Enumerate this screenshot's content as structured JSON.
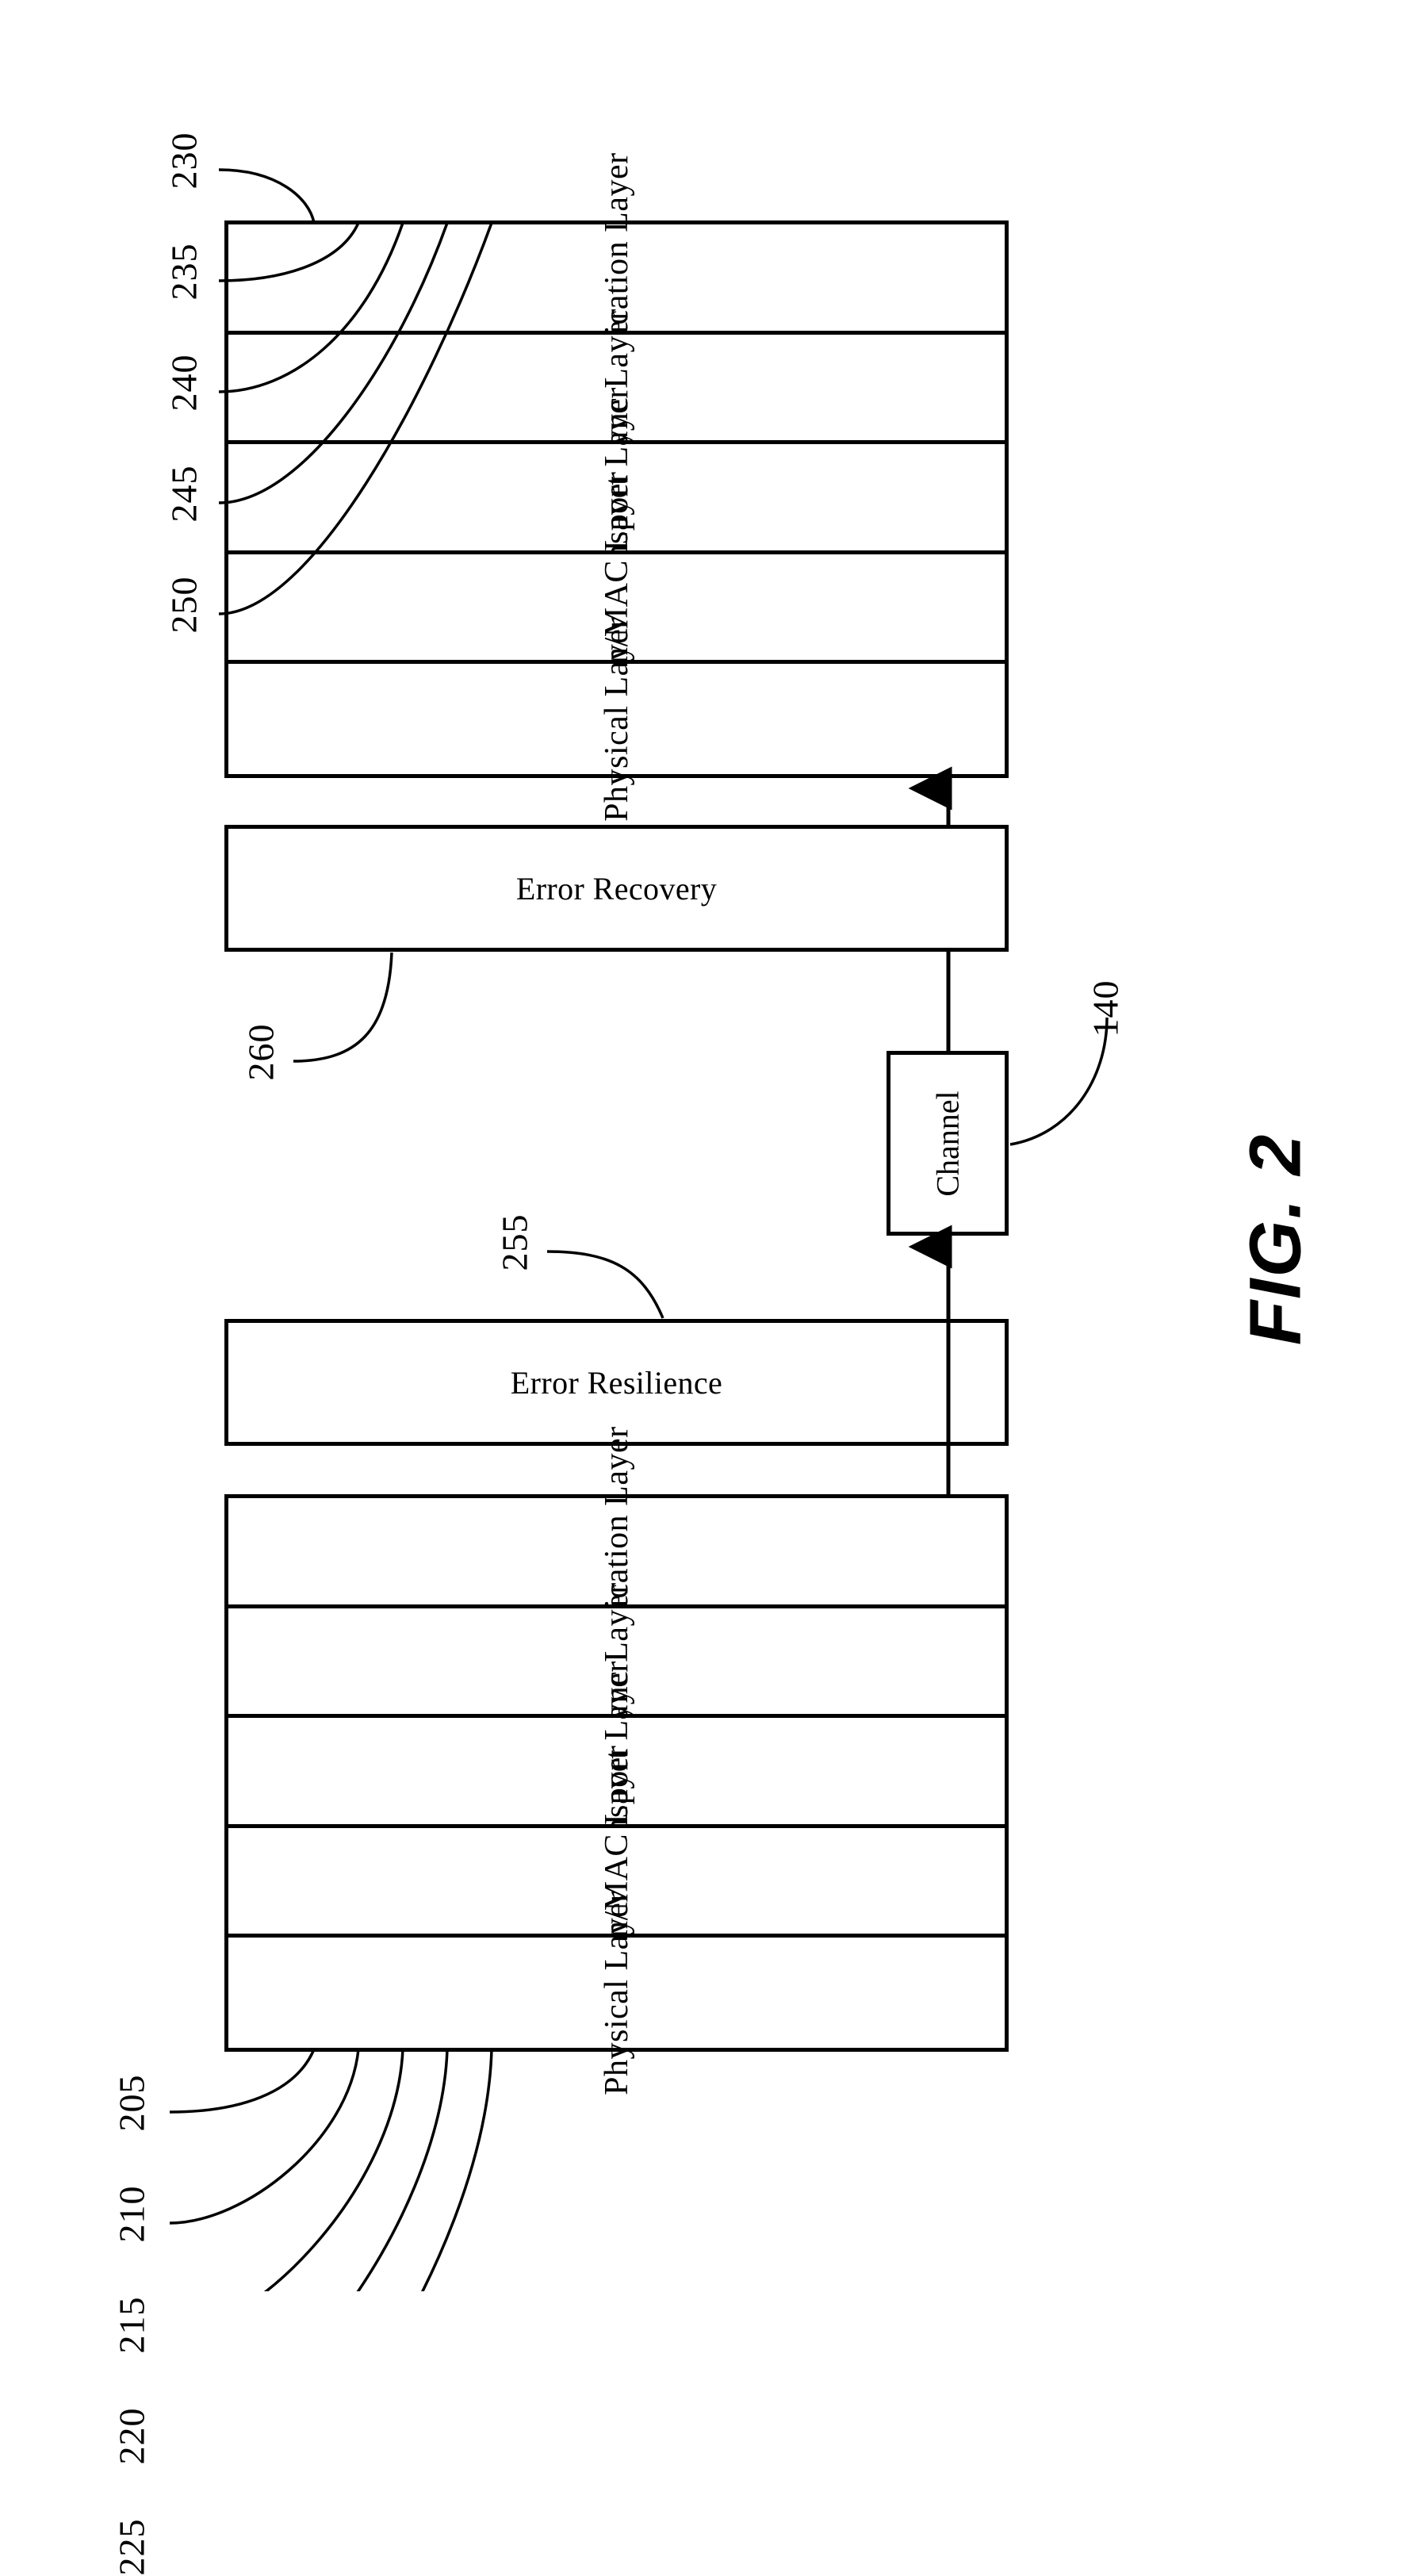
{
  "figure": {
    "caption": "FIG. 2",
    "receiver_stack": {
      "name": "receiver-protocol-stack",
      "layers": [
        {
          "label": "Application Layer",
          "ref": "230"
        },
        {
          "label": "Sync Layer",
          "ref": "235"
        },
        {
          "label": "Transport Layer",
          "ref": "240"
        },
        {
          "label": "Stream/MAC Layer",
          "ref": "245"
        },
        {
          "label": "Physical Layer",
          "ref": "250"
        }
      ]
    },
    "transmitter_stack": {
      "name": "transmitter-protocol-stack",
      "layers": [
        {
          "label": "Application Layer",
          "ref": "205"
        },
        {
          "label": "Sync Layer",
          "ref": "210"
        },
        {
          "label": "Transport Layer",
          "ref": "215"
        },
        {
          "label": "Stream/MAC Layer",
          "ref": "220"
        },
        {
          "label": "Physical Layer",
          "ref": "225"
        }
      ]
    },
    "error_recovery": {
      "label": "Error Recovery",
      "ref": "260"
    },
    "error_resilience": {
      "label": "Error Resilience",
      "ref": "255"
    },
    "channel": {
      "label": "Channel",
      "ref": "140"
    },
    "colors": {
      "ink": "#000000",
      "paper": "#ffffff"
    }
  }
}
